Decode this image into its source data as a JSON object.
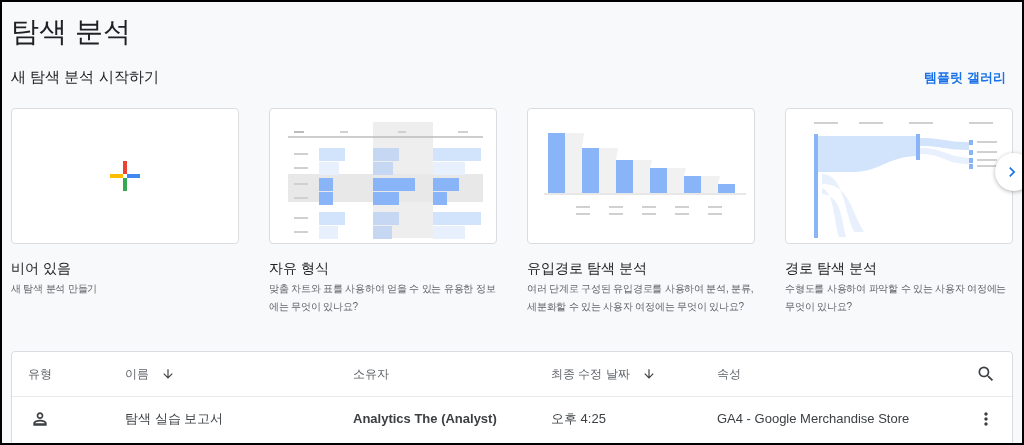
{
  "title": "탐색 분석",
  "subtitle": "새 탐색 분석 시작하기",
  "gallery_link": "템플릿 갤러리",
  "templates": [
    {
      "kind": "blank",
      "title": "비어 있음",
      "description": "새 탐색 분석 만들기"
    },
    {
      "kind": "freeform",
      "title": "자유 형식",
      "description": "맞춤 차트와 표를 사용하여 얻을 수 있는 유용한 정보에는 무엇이 있나요?"
    },
    {
      "kind": "funnel",
      "title": "유입경로 탐색 분석",
      "description": "여러 단계로 구성된 유입경로를 사용하여 분석, 분류, 세분화할 수 있는 사용자 여정에는 무엇이 있나요?"
    },
    {
      "kind": "path",
      "title": "경로 탐색 분석",
      "description": "수형도를 사용하여 파악할 수 있는 사용자 여정에는 무엇이 있나요?"
    }
  ],
  "table": {
    "columns": [
      {
        "label": "유형",
        "sorted": false
      },
      {
        "label": "이름",
        "sorted": true
      },
      {
        "label": "소유자",
        "sorted": false
      },
      {
        "label": "최종 수정 날짜",
        "sorted": true
      },
      {
        "label": "속성",
        "sorted": false
      }
    ],
    "rows": [
      {
        "kind": "person",
        "name": "탐색 실습 보고서",
        "owner": "Analytics The (Analyst)",
        "modified": "오후 4:25",
        "property": "GA4 - Google Merchandise Store"
      }
    ]
  }
}
